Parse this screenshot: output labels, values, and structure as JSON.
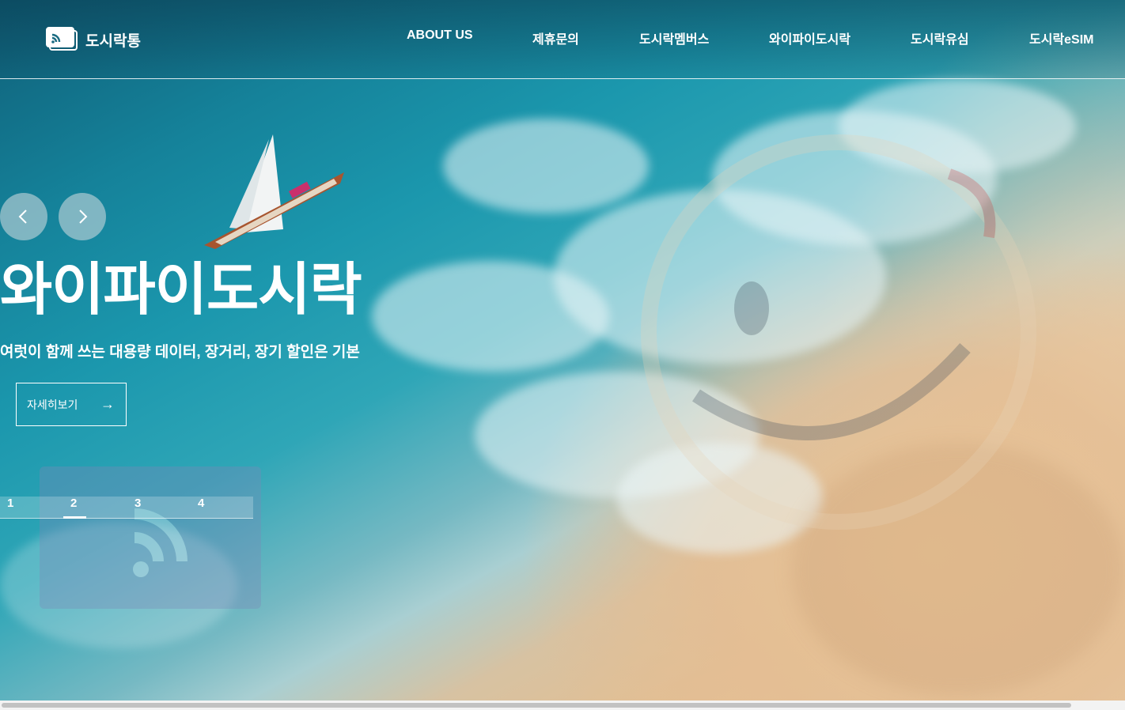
{
  "brand": {
    "name": "도시락통",
    "icon": "wifi-card-logo-icon"
  },
  "nav": {
    "items": [
      {
        "label": "ABOUT US"
      },
      {
        "label": "제휴문의"
      },
      {
        "label": "도시락멤버스"
      },
      {
        "label": "와이파이도시락"
      },
      {
        "label": "도시락유심"
      },
      {
        "label": "도시락eSIM"
      }
    ]
  },
  "hero": {
    "title": "와이파이도시락",
    "subtitle": "여럿이 함께 쓰는 대용량 데이터, 장거리, 장기 할인은 기본",
    "button_label": "자세히보기",
    "button_icon": "arrow-right-icon",
    "prev_icon": "chevron-left-icon",
    "next_icon": "chevron-right-icon"
  },
  "pagination": {
    "pages": [
      "1",
      "2",
      "3",
      "4"
    ],
    "active": "2"
  },
  "colors": {
    "sea_dark": "#0f5f78",
    "sea_mid": "#1b97ad",
    "sand": "#e2bf93",
    "text": "#ffffff"
  }
}
